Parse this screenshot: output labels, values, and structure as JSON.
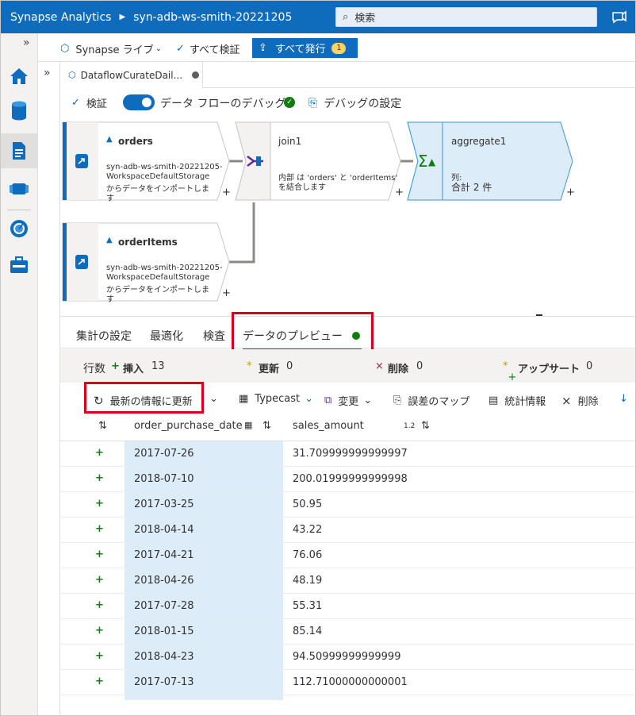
{
  "topbar": {
    "app": "Synapse Analytics",
    "workspace": "syn-adb-ws-smith-20221205",
    "search_placeholder": "検索"
  },
  "commandbar": {
    "live": "Synapse ライブ",
    "validate_all": "すべて検証",
    "publish_all": "すべて発行",
    "publish_count": "1"
  },
  "tab": {
    "title": "DataflowCurateDail..."
  },
  "toolbar": {
    "validate": "検証",
    "debug_label": "データ フローのデバッグ",
    "debug_settings": "デバッグの設定"
  },
  "nodes": {
    "orders": {
      "title": "orders",
      "line1": "syn-adb-ws-smith-20221205-",
      "line2": "WorkspaceDefaultStorage",
      "line3": "からデータをインポートしま",
      "line4": "す"
    },
    "join1": {
      "title": "join1",
      "line1": "内部 は 'orders' と 'orderItems'",
      "line2": "を結合します"
    },
    "aggregate1": {
      "title": "aggregate1",
      "line1": "列:",
      "line2": "合計 2 件"
    },
    "orderItems": {
      "title": "orderItems",
      "line1": "syn-adb-ws-smith-20221205-",
      "line2": "WorkspaceDefaultStorage",
      "line3": "からデータをインポートしま",
      "line4": "す"
    }
  },
  "panel_tabs": [
    "集計の設定",
    "最適化",
    "検査",
    "データのプレビュー"
  ],
  "stats": {
    "rows_label": "行数",
    "insert_label": "挿入",
    "insert_count": "13",
    "update_label": "更新",
    "update_count": "0",
    "delete_label": "削除",
    "delete_count": "0",
    "upsert_label": "アップサート",
    "upsert_count": "0"
  },
  "grid_toolbar": {
    "refresh": "最新の情報に更新",
    "typecast": "Typecast",
    "modify": "変更",
    "map_drifted": "誤差のマップ",
    "statistics": "統計情報",
    "remove": "削除"
  },
  "grid": {
    "columns": [
      "order_purchase_date",
      "sales_amount"
    ],
    "number_badge": "1.2",
    "rows": [
      [
        "2017-07-26",
        "31.709999999999997"
      ],
      [
        "2018-07-10",
        "200.01999999999998"
      ],
      [
        "2017-03-25",
        "50.95"
      ],
      [
        "2018-04-14",
        "43.22"
      ],
      [
        "2017-04-21",
        "76.06"
      ],
      [
        "2018-04-26",
        "48.19"
      ],
      [
        "2017-07-28",
        "55.31"
      ],
      [
        "2018-01-15",
        "85.14"
      ],
      [
        "2018-04-23",
        "94.50999999999999"
      ],
      [
        "2017-07-13",
        "112.71000000000001"
      ]
    ]
  },
  "colors": {
    "accent": "#0f6cbd",
    "highlight_box": "#d9001b",
    "selected_column": "#ddecf9",
    "ok_green": "#107c10"
  }
}
